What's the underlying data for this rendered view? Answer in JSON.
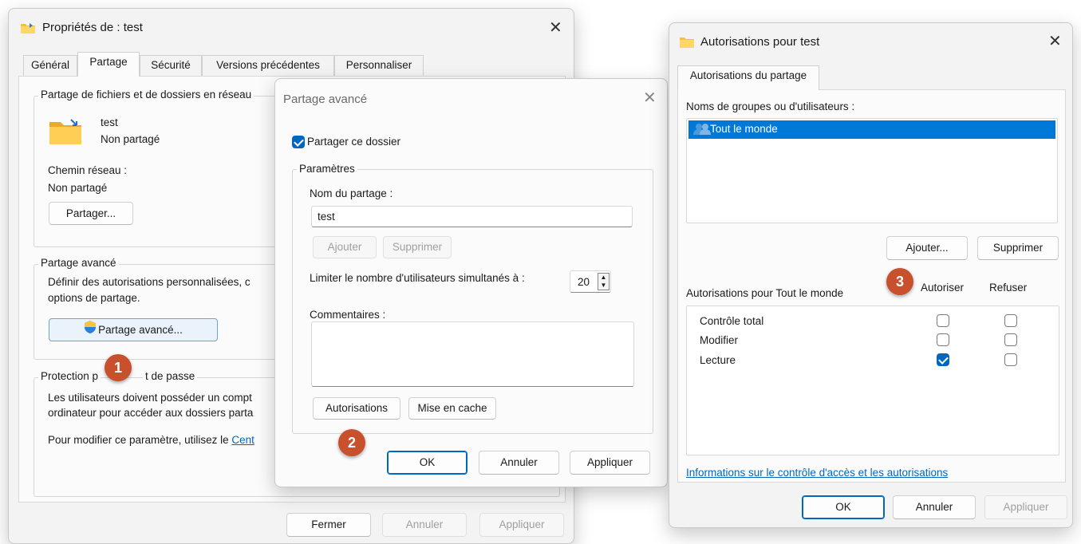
{
  "props": {
    "title": "Propriétés de : test",
    "tabs": [
      "Général",
      "Partage",
      "Sécurité",
      "Versions précédentes",
      "Personnaliser"
    ],
    "network_group": "Partage de fichiers et de dossiers en réseau",
    "folder_name": "test",
    "folder_status": "Non partagé",
    "path_label": "Chemin réseau :",
    "path_value": "Non partagé",
    "share_button": "Partager...",
    "advanced_group": "Partage avancé",
    "advanced_desc1": "Définir des autorisations personnalisées, c",
    "advanced_desc2": "options de partage.",
    "advanced_button": "Partage avancé...",
    "pw_group_a": "Protection p",
    "pw_group_b": "t de passe",
    "pw_desc1": "Les utilisateurs doivent posséder un compt",
    "pw_desc2": "ordinateur pour accéder aux dossiers parta",
    "pw_modify": "Pour modifier ce paramètre, utilisez le ",
    "pw_link": "Cent",
    "close_button": "Fermer",
    "cancel_button": "Annuler",
    "apply_button": "Appliquer"
  },
  "advanced": {
    "title": "Partage avancé",
    "share_checkbox": "Partager ce dossier",
    "share_checked": true,
    "params_group": "Paramètres",
    "share_name_label": "Nom du partage :",
    "share_name_value": "test",
    "add_button": "Ajouter",
    "remove_button": "Supprimer",
    "limit_label": "Limiter le nombre d'utilisateurs simultanés à :",
    "limit_value": "20",
    "comments_label": "Commentaires :",
    "permissions_button": "Autorisations",
    "cache_button": "Mise en cache",
    "ok_button": "OK",
    "cancel_button": "Annuler",
    "apply_button": "Appliquer"
  },
  "perms": {
    "title": "Autorisations pour test",
    "tab": "Autorisations du partage",
    "groups_label": "Noms de groupes ou d'utilisateurs :",
    "users": [
      "Tout le monde"
    ],
    "add_button": "Ajouter...",
    "remove_button": "Supprimer",
    "perms_for": "Autorisations pour Tout le monde",
    "allow_header": "Autoriser",
    "deny_header": "Refuser",
    "rows": [
      {
        "name": "Contrôle total",
        "allow": false,
        "deny": false
      },
      {
        "name": "Modifier",
        "allow": false,
        "deny": false
      },
      {
        "name": "Lecture",
        "allow": true,
        "deny": false
      }
    ],
    "info_link": "Informations sur le contrôle d'accès et les autorisations",
    "ok_button": "OK",
    "cancel_button": "Annuler",
    "apply_button": "Appliquer"
  },
  "badges": [
    "1",
    "2",
    "3"
  ],
  "colors": {
    "accent": "#0067c0",
    "badge": "#c9502d",
    "selection": "#0078d7"
  }
}
